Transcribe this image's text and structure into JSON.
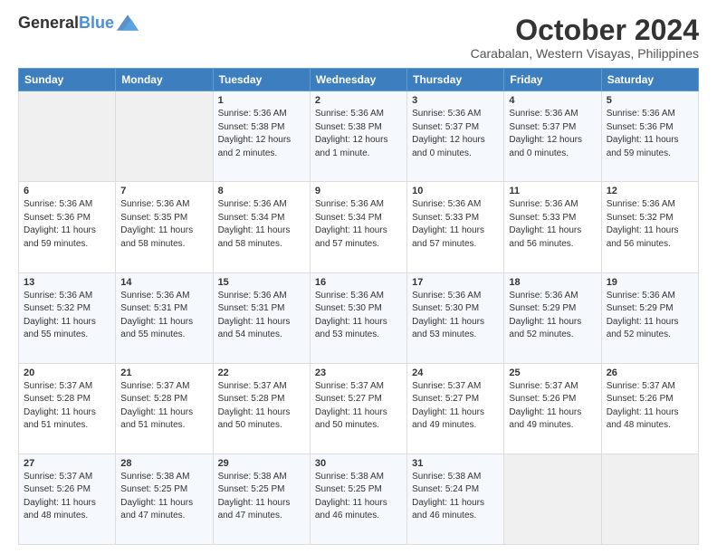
{
  "logo": {
    "line1": "General",
    "line2": "Blue"
  },
  "title": "October 2024",
  "location": "Carabalan, Western Visayas, Philippines",
  "headers": [
    "Sunday",
    "Monday",
    "Tuesday",
    "Wednesday",
    "Thursday",
    "Friday",
    "Saturday"
  ],
  "weeks": [
    [
      {
        "day": "",
        "info": ""
      },
      {
        "day": "",
        "info": ""
      },
      {
        "day": "1",
        "info": "Sunrise: 5:36 AM\nSunset: 5:38 PM\nDaylight: 12 hours\nand 2 minutes."
      },
      {
        "day": "2",
        "info": "Sunrise: 5:36 AM\nSunset: 5:38 PM\nDaylight: 12 hours\nand 1 minute."
      },
      {
        "day": "3",
        "info": "Sunrise: 5:36 AM\nSunset: 5:37 PM\nDaylight: 12 hours\nand 0 minutes."
      },
      {
        "day": "4",
        "info": "Sunrise: 5:36 AM\nSunset: 5:37 PM\nDaylight: 12 hours\nand 0 minutes."
      },
      {
        "day": "5",
        "info": "Sunrise: 5:36 AM\nSunset: 5:36 PM\nDaylight: 11 hours\nand 59 minutes."
      }
    ],
    [
      {
        "day": "6",
        "info": "Sunrise: 5:36 AM\nSunset: 5:36 PM\nDaylight: 11 hours\nand 59 minutes."
      },
      {
        "day": "7",
        "info": "Sunrise: 5:36 AM\nSunset: 5:35 PM\nDaylight: 11 hours\nand 58 minutes."
      },
      {
        "day": "8",
        "info": "Sunrise: 5:36 AM\nSunset: 5:34 PM\nDaylight: 11 hours\nand 58 minutes."
      },
      {
        "day": "9",
        "info": "Sunrise: 5:36 AM\nSunset: 5:34 PM\nDaylight: 11 hours\nand 57 minutes."
      },
      {
        "day": "10",
        "info": "Sunrise: 5:36 AM\nSunset: 5:33 PM\nDaylight: 11 hours\nand 57 minutes."
      },
      {
        "day": "11",
        "info": "Sunrise: 5:36 AM\nSunset: 5:33 PM\nDaylight: 11 hours\nand 56 minutes."
      },
      {
        "day": "12",
        "info": "Sunrise: 5:36 AM\nSunset: 5:32 PM\nDaylight: 11 hours\nand 56 minutes."
      }
    ],
    [
      {
        "day": "13",
        "info": "Sunrise: 5:36 AM\nSunset: 5:32 PM\nDaylight: 11 hours\nand 55 minutes."
      },
      {
        "day": "14",
        "info": "Sunrise: 5:36 AM\nSunset: 5:31 PM\nDaylight: 11 hours\nand 55 minutes."
      },
      {
        "day": "15",
        "info": "Sunrise: 5:36 AM\nSunset: 5:31 PM\nDaylight: 11 hours\nand 54 minutes."
      },
      {
        "day": "16",
        "info": "Sunrise: 5:36 AM\nSunset: 5:30 PM\nDaylight: 11 hours\nand 53 minutes."
      },
      {
        "day": "17",
        "info": "Sunrise: 5:36 AM\nSunset: 5:30 PM\nDaylight: 11 hours\nand 53 minutes."
      },
      {
        "day": "18",
        "info": "Sunrise: 5:36 AM\nSunset: 5:29 PM\nDaylight: 11 hours\nand 52 minutes."
      },
      {
        "day": "19",
        "info": "Sunrise: 5:36 AM\nSunset: 5:29 PM\nDaylight: 11 hours\nand 52 minutes."
      }
    ],
    [
      {
        "day": "20",
        "info": "Sunrise: 5:37 AM\nSunset: 5:28 PM\nDaylight: 11 hours\nand 51 minutes."
      },
      {
        "day": "21",
        "info": "Sunrise: 5:37 AM\nSunset: 5:28 PM\nDaylight: 11 hours\nand 51 minutes."
      },
      {
        "day": "22",
        "info": "Sunrise: 5:37 AM\nSunset: 5:28 PM\nDaylight: 11 hours\nand 50 minutes."
      },
      {
        "day": "23",
        "info": "Sunrise: 5:37 AM\nSunset: 5:27 PM\nDaylight: 11 hours\nand 50 minutes."
      },
      {
        "day": "24",
        "info": "Sunrise: 5:37 AM\nSunset: 5:27 PM\nDaylight: 11 hours\nand 49 minutes."
      },
      {
        "day": "25",
        "info": "Sunrise: 5:37 AM\nSunset: 5:26 PM\nDaylight: 11 hours\nand 49 minutes."
      },
      {
        "day": "26",
        "info": "Sunrise: 5:37 AM\nSunset: 5:26 PM\nDaylight: 11 hours\nand 48 minutes."
      }
    ],
    [
      {
        "day": "27",
        "info": "Sunrise: 5:37 AM\nSunset: 5:26 PM\nDaylight: 11 hours\nand 48 minutes."
      },
      {
        "day": "28",
        "info": "Sunrise: 5:38 AM\nSunset: 5:25 PM\nDaylight: 11 hours\nand 47 minutes."
      },
      {
        "day": "29",
        "info": "Sunrise: 5:38 AM\nSunset: 5:25 PM\nDaylight: 11 hours\nand 47 minutes."
      },
      {
        "day": "30",
        "info": "Sunrise: 5:38 AM\nSunset: 5:25 PM\nDaylight: 11 hours\nand 46 minutes."
      },
      {
        "day": "31",
        "info": "Sunrise: 5:38 AM\nSunset: 5:24 PM\nDaylight: 11 hours\nand 46 minutes."
      },
      {
        "day": "",
        "info": ""
      },
      {
        "day": "",
        "info": ""
      }
    ]
  ]
}
